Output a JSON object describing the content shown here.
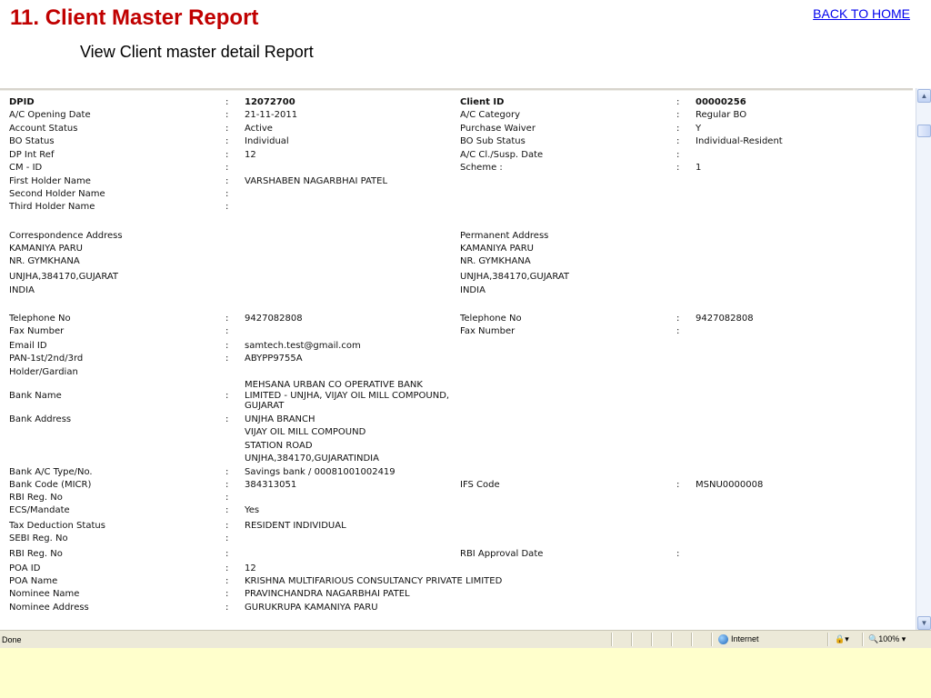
{
  "slide": {
    "title": "11. Client Master Report",
    "subtitle": "View Client master detail Report",
    "back_link": "BACK TO HOME"
  },
  "report": {
    "sep": ":",
    "left": {
      "dpid": {
        "label": "DPID",
        "value": "12072700"
      },
      "opening_date": {
        "label": "A/C Opening Date",
        "value": "21-11-2011"
      },
      "account_status": {
        "label": "Account Status",
        "value": "Active"
      },
      "bo_status": {
        "label": "BO Status",
        "value": "Individual"
      },
      "dp_int_ref": {
        "label": "DP Int Ref",
        "value": "12"
      },
      "cm_id": {
        "label": "CM - ID",
        "value": ""
      },
      "first_holder": {
        "label": "First Holder Name",
        "value": "VARSHABEN NAGARBHAI PATEL"
      },
      "second_holder": {
        "label": "Second Holder Name",
        "value": ""
      },
      "third_holder": {
        "label": "Third Holder Name",
        "value": ""
      },
      "telephone": {
        "label": "Telephone No",
        "value": "9427082808"
      },
      "fax": {
        "label": "Fax Number",
        "value": ""
      },
      "email": {
        "label": "Email ID",
        "value": "samtech.test@gmail.com"
      },
      "pan_line1": {
        "label": "PAN-1st/2nd/3rd",
        "value": "ABYPP9755A"
      },
      "pan_line2": {
        "label": "Holder/Gardian"
      },
      "bank_name": {
        "label": "Bank Name",
        "value_lines": [
          "MEHSANA URBAN CO OPERATIVE BANK",
          "LIMITED - UNJHA, VIJAY OIL MILL COMPOUND,",
          "GUJARAT"
        ]
      },
      "bank_address": {
        "label": "Bank Address",
        "value_lines": [
          "UNJHA BRANCH",
          "VIJAY OIL MILL COMPOUND",
          "STATION ROAD",
          "UNJHA,384170,GUJARATINDIA"
        ]
      },
      "bank_type": {
        "label": "Bank A/C Type/No.",
        "value": "Savings bank / 00081001002419"
      },
      "bank_code": {
        "label": "Bank Code (MICR)",
        "value": "384313051"
      },
      "rbi_reg1": {
        "label": "RBI Reg. No",
        "value": ""
      },
      "ecs": {
        "label": "ECS/Mandate",
        "value": "Yes"
      },
      "tax": {
        "label": "Tax Deduction Status",
        "value": "RESIDENT INDIVIDUAL"
      },
      "sebi": {
        "label": "SEBI Reg. No",
        "value": ""
      },
      "rbi_reg2": {
        "label": "RBI Reg. No",
        "value": ""
      },
      "poa_id": {
        "label": "POA ID",
        "value": "12"
      },
      "poa_name": {
        "label": "POA Name",
        "value": "KRISHNA MULTIFARIOUS CONSULTANCY PRIVATE LIMITED"
      },
      "nominee_name": {
        "label": "Nominee Name",
        "value": "PRAVINCHANDRA NAGARBHAI PATEL"
      },
      "nominee_address": {
        "label": "Nominee Address",
        "value": "GURUKRUPA KAMANIYA PARU"
      }
    },
    "right": {
      "client_id": {
        "label": "Client ID",
        "value": "00000256"
      },
      "category": {
        "label": "A/C Category",
        "value": "Regular BO"
      },
      "purchase_waiver": {
        "label": "Purchase Waiver",
        "value": "Y"
      },
      "bo_sub_status": {
        "label": "BO Sub Status",
        "value": "Individual-Resident"
      },
      "cl_susp_date": {
        "label": "A/C Cl./Susp. Date",
        "value": ""
      },
      "scheme": {
        "label": "Scheme :",
        "value": "1"
      },
      "telephone": {
        "label": "Telephone No",
        "value": "9427082808"
      },
      "fax": {
        "label": "Fax Number",
        "value": ""
      },
      "ifs_code": {
        "label": "IFS Code",
        "value": "MSNU0000008"
      },
      "rbi_approval": {
        "label": "RBI Approval Date",
        "value": ""
      }
    },
    "correspondence": {
      "heading": "Correspondence Address",
      "lines": [
        "KAMANIYA PARU",
        "NR. GYMKHANA",
        "UNJHA,384170,GUJARAT",
        "INDIA"
      ]
    },
    "permanent": {
      "heading": "Permanent Address",
      "lines": [
        "KAMANIYA PARU",
        "NR. GYMKHANA",
        "UNJHA,384170,GUJARAT",
        "INDIA"
      ]
    }
  },
  "statusbar": {
    "status_text": "Done",
    "zone": "Internet",
    "zoom": "100%"
  },
  "icons": {
    "scroll_up": "▲",
    "scroll_down": "▼",
    "protected_mode": "🔒",
    "zoom_glass": "🔍",
    "dropdown": "▾"
  }
}
